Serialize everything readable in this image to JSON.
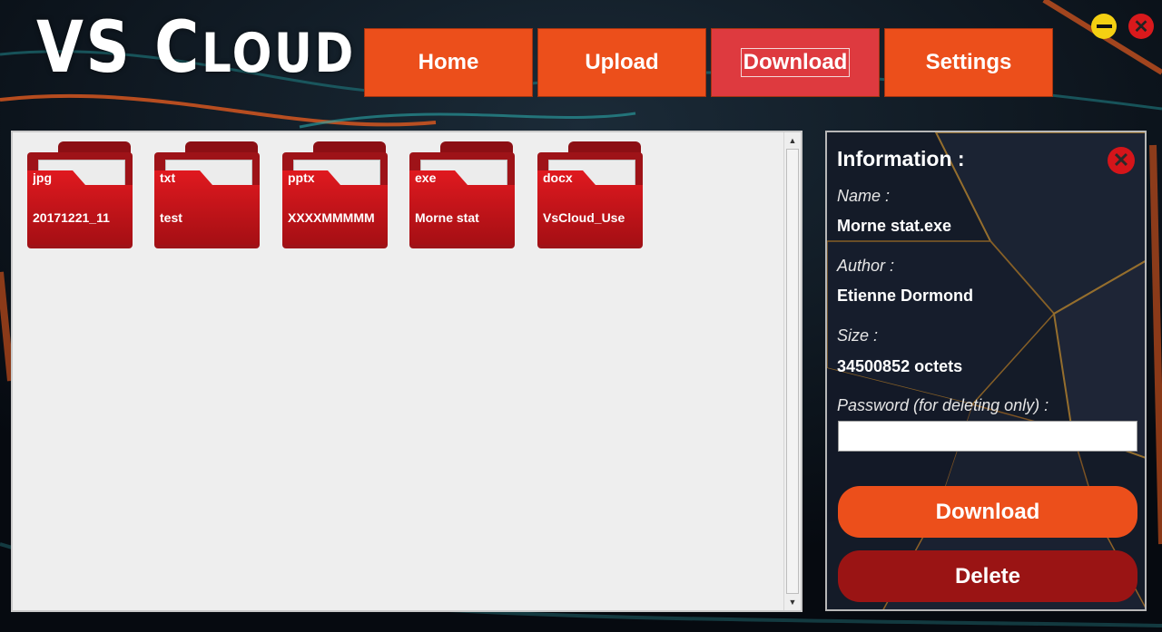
{
  "app": {
    "logo_part1": "VS",
    "logo_big_c": "C",
    "logo_rest": "LOUD"
  },
  "nav": {
    "items": [
      {
        "label": "Home"
      },
      {
        "label": "Upload"
      },
      {
        "label": "Download"
      },
      {
        "label": "Settings"
      }
    ],
    "active": "Download"
  },
  "window_controls": {
    "minimize_icon": "minimize-icon",
    "close_icon": "close-icon",
    "close_glyph": "✕"
  },
  "files": [
    {
      "ext": "jpg",
      "name": "20171221_11"
    },
    {
      "ext": "txt",
      "name": "test"
    },
    {
      "ext": "pptx",
      "name": "XXXXMMMMM"
    },
    {
      "ext": "exe",
      "name": "Morne stat"
    },
    {
      "ext": "docx",
      "name": "VsCloud_Use"
    }
  ],
  "info": {
    "title": "Information :",
    "close_glyph": "✕",
    "name_label": "Name :",
    "name_value": "Morne stat.exe",
    "author_label": "Author :",
    "author_value": "Etienne Dormond",
    "size_label": "Size :",
    "size_value": "34500852 octets",
    "password_label": "Password (for deleting only) :",
    "password_value": "",
    "download_label": "Download",
    "delete_label": "Delete"
  },
  "scrollbar": {
    "up_glyph": "▲",
    "down_glyph": "▼"
  },
  "colors": {
    "accent": "#ec4f1b",
    "active_tab": "#de3a3f",
    "folder": "#9e1318",
    "delete": "#9a1414"
  }
}
